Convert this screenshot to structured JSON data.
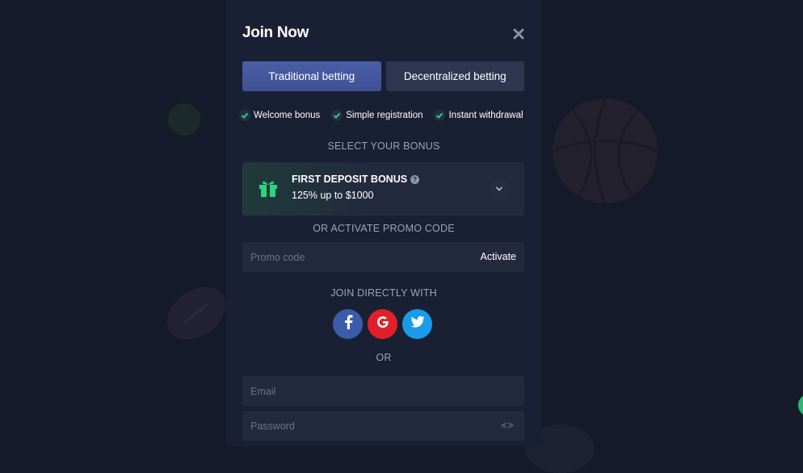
{
  "modal": {
    "title": "Join Now",
    "tabs": [
      {
        "label": "Traditional betting",
        "active": true
      },
      {
        "label": "Decentralized betting",
        "active": false
      }
    ],
    "perks": [
      "Welcome bonus",
      "Simple registration",
      "Instant withdrawal"
    ]
  },
  "bonus": {
    "section_label": "SELECT YOUR BONUS",
    "title": "FIRST DEPOSIT BONUS",
    "amount": "125% up to $1000",
    "help_icon": "question-circle-icon"
  },
  "promo": {
    "section_label": "OR ACTIVATE PROMO CODE",
    "placeholder": "Promo code",
    "value": "",
    "action_label": "Activate"
  },
  "social": {
    "section_label": "JOIN DIRECTLY WITH",
    "providers": [
      "facebook-icon",
      "google-icon",
      "twitter-icon"
    ]
  },
  "or_label": "OR",
  "form": {
    "email_placeholder": "Email",
    "password_placeholder": "Password"
  },
  "colors": {
    "background": "#151a2b",
    "modal": "#1a2033",
    "accent_tab": "#4b5ea6",
    "check": "#2bd47a",
    "facebook": "#3b5ca8",
    "google": "#e0202b",
    "twitter": "#1a9bea"
  }
}
